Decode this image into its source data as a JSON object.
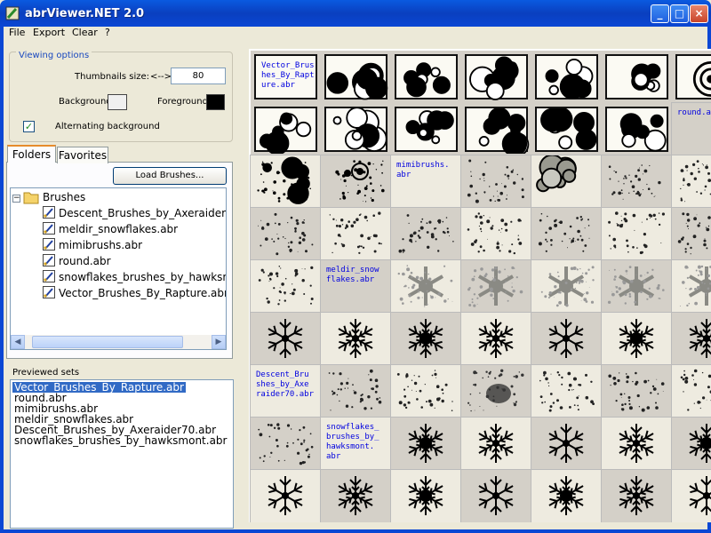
{
  "window": {
    "title": "abrViewer.NET 2.0",
    "controls": [
      "_",
      "□",
      "×"
    ]
  },
  "menu": [
    "File",
    "Export",
    "Clear",
    "?"
  ],
  "viewing_options": {
    "legend": "Viewing options",
    "thumb_label": "Thumbnails size:",
    "thumb_arrow": "<-->",
    "thumb_value": "80",
    "background_label": "Background:",
    "background_color": "#f0f0f0",
    "foreground_label": "Foreground:",
    "foreground_color": "#000000",
    "alternating_label": "Alternating background",
    "alternating_checked": true
  },
  "tabs": {
    "folders": "Folders",
    "favorites": "Favorites"
  },
  "load_button": "Load Brushes...",
  "tree": {
    "root": "Brushes",
    "items": [
      "Descent_Brushes_by_Axeraider70.abr",
      "meldir_snowflakes.abr",
      "mimibrushs.abr",
      "round.abr",
      "snowflakes_brushes_by_hawksmont.abr",
      "Vector_Brushes_By_Rapture.abr"
    ]
  },
  "previewed": {
    "label": "Previewed sets",
    "items": [
      "Vector_Brushes_By_Rapture.abr",
      "round.abr",
      "mimibrushs.abr",
      "meldir_snowflakes.abr",
      "Descent_Brushes_by_Axeraider70.abr",
      "snowflakes_brushes_by_hawksmont.abr"
    ],
    "selected_index": 0
  },
  "grid": {
    "labels": {
      "vector": "Vector_Brus hes_By_Rapt ure.abr",
      "round": "round.a",
      "mimi": "mimibrushs. abr",
      "meldir": "meldir_snow flakes.abr",
      "descent": "Descent_Bru shes_by_Axe raider70.abr",
      "snow": "snowflakes_ brushes_by_ hawksmont. abr"
    }
  }
}
